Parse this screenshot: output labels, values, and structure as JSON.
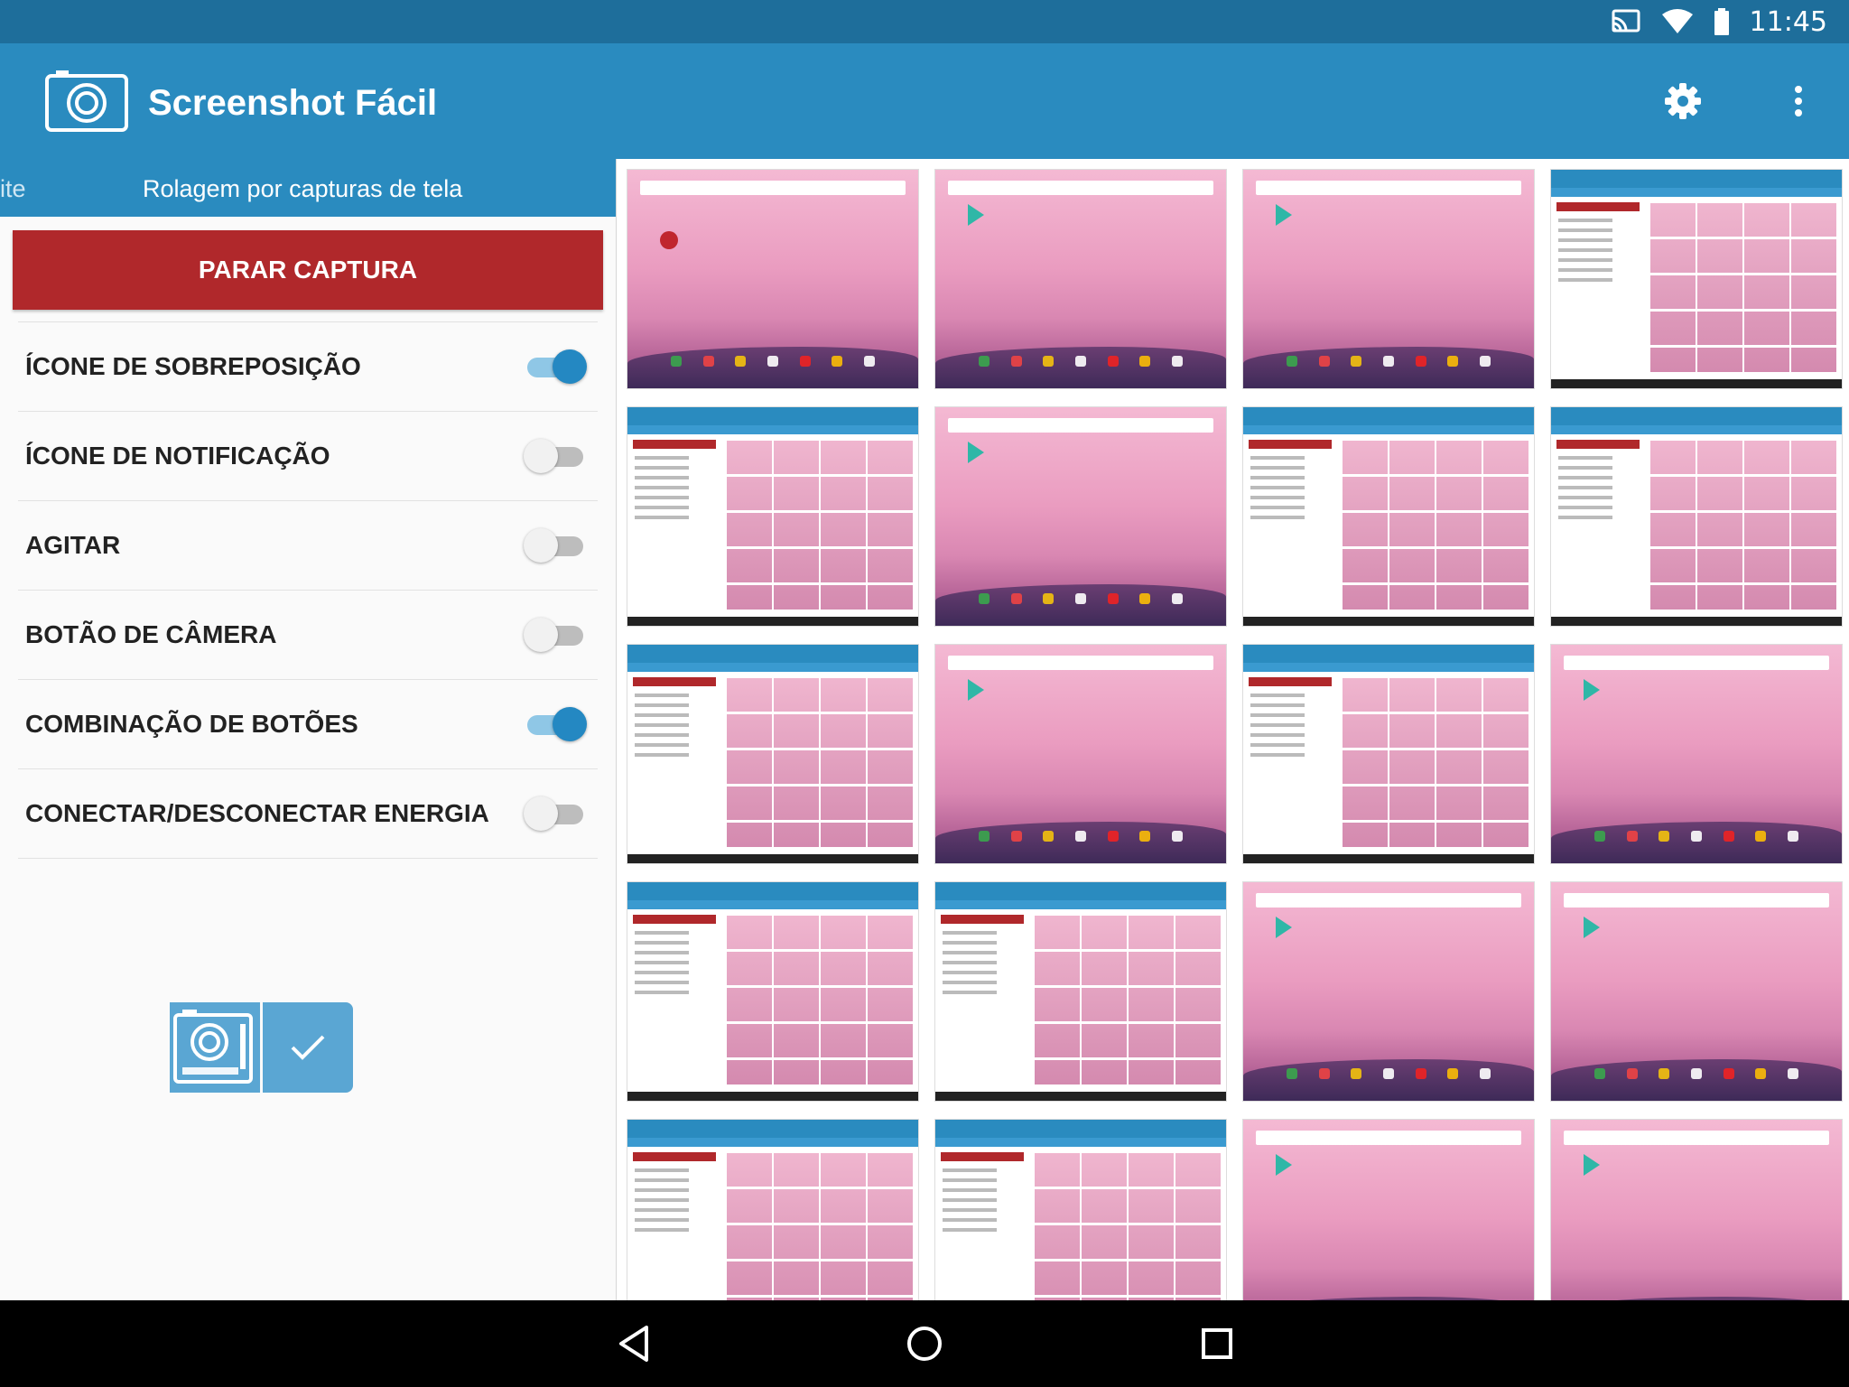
{
  "status_bar": {
    "time": "11:45"
  },
  "app_bar": {
    "title": "Screenshot Fácil"
  },
  "tabs": {
    "partial": "ite",
    "active": "Rolagem por capturas de tela"
  },
  "stop_button_label": "PARAR CAPTURA",
  "settings": [
    {
      "label": "ÍCONE DE SOBREPOSIÇÃO",
      "on": true
    },
    {
      "label": "ÍCONE DE NOTIFICAÇÃO",
      "on": false
    },
    {
      "label": "AGITAR",
      "on": false
    },
    {
      "label": "BOTÃO DE CÂMERA",
      "on": false
    },
    {
      "label": "COMBINAÇÃO DE BOTÕES",
      "on": true
    },
    {
      "label": "CONECTAR/DESCONECTAR ENERGIA",
      "on": false
    }
  ],
  "colors": {
    "primary": "#2a8bbf",
    "status": "#1e6e9b",
    "accent": "#2488c2",
    "danger": "#b0282b"
  },
  "icons": {
    "status": [
      "cast-icon",
      "wifi-icon",
      "battery-icon"
    ],
    "app_bar": [
      "camera-logo-icon",
      "gear-icon",
      "more-vert-icon"
    ],
    "overlay": [
      "camera-icon",
      "check-icon"
    ],
    "nav": [
      "back-icon",
      "home-icon",
      "recents-icon"
    ]
  },
  "thumbnail_grid": {
    "columns": 4,
    "tiles": [
      "home",
      "home",
      "home",
      "app",
      "app",
      "home",
      "app",
      "app",
      "app",
      "home",
      "app",
      "home",
      "app",
      "app",
      "home",
      "home",
      "app",
      "app",
      "home",
      "home"
    ]
  }
}
